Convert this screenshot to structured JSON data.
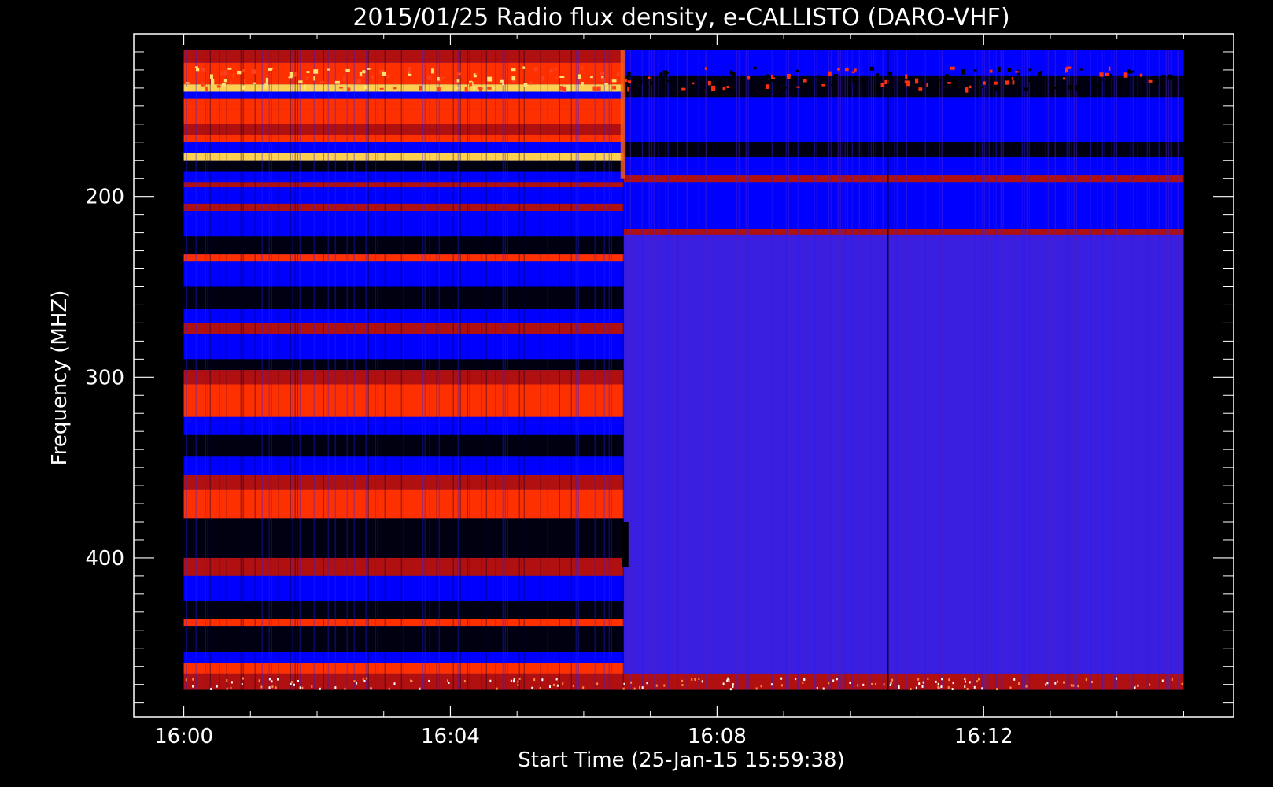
{
  "chart_data": {
    "type": "heatmap",
    "title": "2015/01/25  Radio flux density, e-CALLISTO (DARO-VHF)",
    "xlabel": "Start Time (25-Jan-15 15:59:38)",
    "ylabel": "Frequency (MHZ)",
    "x_tick_labels": [
      "16:00",
      "16:04",
      "16:08",
      "16:12"
    ],
    "x_tick_minutes": [
      0,
      4,
      8,
      12
    ],
    "y_tick_labels": [
      "200",
      "300",
      "400"
    ],
    "y_tick_values": [
      200,
      300,
      400
    ],
    "x_range_minutes": [
      -0.75,
      15.75
    ],
    "y_range_mhz": [
      110,
      488
    ],
    "data_time_range_minutes": [
      0,
      15
    ],
    "data_freq_range_mhz": [
      119,
      473
    ],
    "colors": {
      "background": "#000000",
      "low": "#0000ff",
      "mid": "#b01010",
      "high": "#ff3000",
      "peak": "#ffd050",
      "quiet_after_break": "#3a1fe0"
    },
    "regime_change_minute": 6.6,
    "vertical_dark_line_minute": 10.55,
    "bands_before": [
      {
        "f0": 119,
        "f1": 126,
        "level": "mid"
      },
      {
        "f0": 126,
        "f1": 138,
        "level": "high"
      },
      {
        "f0": 138,
        "f1": 142,
        "level": "peak"
      },
      {
        "f0": 142,
        "f1": 146,
        "level": "low"
      },
      {
        "f0": 146,
        "f1": 152,
        "level": "high"
      },
      {
        "f0": 152,
        "f1": 160,
        "level": "high"
      },
      {
        "f0": 160,
        "f1": 166,
        "level": "mid"
      },
      {
        "f0": 166,
        "f1": 170,
        "level": "high"
      },
      {
        "f0": 170,
        "f1": 176,
        "level": "low"
      },
      {
        "f0": 176,
        "f1": 180,
        "level": "peak"
      },
      {
        "f0": 180,
        "f1": 186,
        "level": "black"
      },
      {
        "f0": 186,
        "f1": 192,
        "level": "low"
      },
      {
        "f0": 192,
        "f1": 195,
        "level": "mid"
      },
      {
        "f0": 195,
        "f1": 204,
        "level": "low"
      },
      {
        "f0": 204,
        "f1": 208,
        "level": "mid"
      },
      {
        "f0": 208,
        "f1": 222,
        "level": "low"
      },
      {
        "f0": 222,
        "f1": 232,
        "level": "black"
      },
      {
        "f0": 232,
        "f1": 236,
        "level": "high"
      },
      {
        "f0": 236,
        "f1": 250,
        "level": "low"
      },
      {
        "f0": 250,
        "f1": 262,
        "level": "black"
      },
      {
        "f0": 262,
        "f1": 270,
        "level": "low"
      },
      {
        "f0": 270,
        "f1": 276,
        "level": "mid"
      },
      {
        "f0": 276,
        "f1": 290,
        "level": "low"
      },
      {
        "f0": 290,
        "f1": 296,
        "level": "black"
      },
      {
        "f0": 296,
        "f1": 304,
        "level": "mid"
      },
      {
        "f0": 304,
        "f1": 322,
        "level": "high"
      },
      {
        "f0": 322,
        "f1": 332,
        "level": "low"
      },
      {
        "f0": 332,
        "f1": 344,
        "level": "black"
      },
      {
        "f0": 344,
        "f1": 354,
        "level": "low"
      },
      {
        "f0": 354,
        "f1": 362,
        "level": "mid"
      },
      {
        "f0": 362,
        "f1": 378,
        "level": "high"
      },
      {
        "f0": 378,
        "f1": 400,
        "level": "black"
      },
      {
        "f0": 400,
        "f1": 410,
        "level": "mid"
      },
      {
        "f0": 410,
        "f1": 424,
        "level": "low"
      },
      {
        "f0": 424,
        "f1": 434,
        "level": "black"
      },
      {
        "f0": 434,
        "f1": 438,
        "level": "high"
      },
      {
        "f0": 438,
        "f1": 452,
        "level": "black"
      },
      {
        "f0": 452,
        "f1": 458,
        "level": "low"
      },
      {
        "f0": 458,
        "f1": 464,
        "level": "high"
      },
      {
        "f0": 464,
        "f1": 473,
        "level": "mid"
      }
    ],
    "bands_after": [
      {
        "f0": 119,
        "f1": 133,
        "level": "low"
      },
      {
        "f0": 133,
        "f1": 145,
        "level": "black"
      },
      {
        "f0": 145,
        "f1": 170,
        "level": "low"
      },
      {
        "f0": 170,
        "f1": 178,
        "level": "black"
      },
      {
        "f0": 178,
        "f1": 188,
        "level": "low"
      },
      {
        "f0": 188,
        "f1": 192,
        "level": "mid"
      },
      {
        "f0": 192,
        "f1": 218,
        "level": "low"
      },
      {
        "f0": 218,
        "f1": 221,
        "level": "mid"
      },
      {
        "f0": 221,
        "f1": 464,
        "level": "quiet"
      },
      {
        "f0": 464,
        "f1": 473,
        "level": "mid"
      }
    ]
  }
}
